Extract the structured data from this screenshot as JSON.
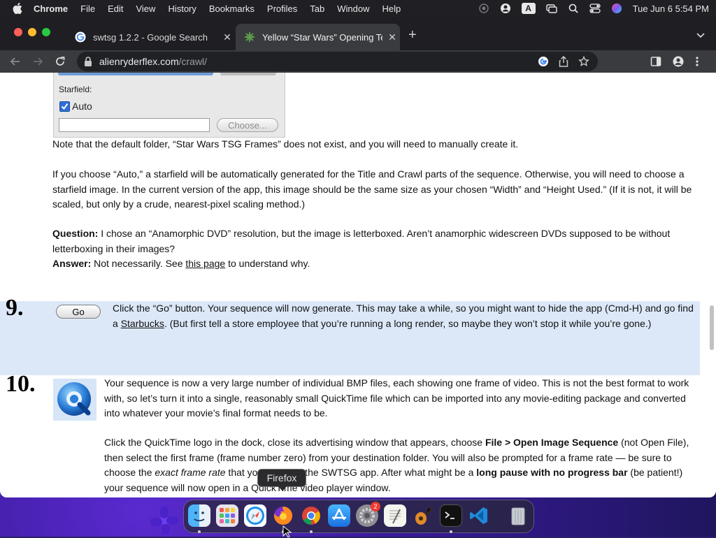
{
  "menubar": {
    "app_name": "Chrome",
    "items": [
      "File",
      "Edit",
      "View",
      "History",
      "Bookmarks",
      "Profiles",
      "Tab",
      "Window",
      "Help"
    ],
    "input_source": "A",
    "clock": "Tue Jun 6  5:54 PM"
  },
  "browser": {
    "tabs": [
      {
        "title": "swtsg 1.2.2 - Google Search",
        "icon": "google-favicon"
      },
      {
        "title": "Yellow “Star Wars” Opening Te",
        "icon": "site-favicon"
      }
    ],
    "url_domain": "alienryderflex.com",
    "url_path": "/crawl/"
  },
  "page": {
    "starfield_label": "Starfield:",
    "auto_label": "Auto",
    "choose_label": "Choose...",
    "note": "Note that the default folder, “Star Wars TSG Frames” does not exist, and you will need to manually create it.",
    "auto_para": "If you choose “Auto,” a starfield will be automatically generated for the Title and Crawl parts of the sequence. Otherwise, you will need to choose a starfield image. In the current version of the app, this image should be the same size as your chosen “Width” and “Height Used.” (If it is not, it will be scaled, but only by a crude, nearest-pixel scaling method.)",
    "question_label": "Question:",
    "question_text": " I chose an “Anamorphic DVD” resolution, but the image is letterboxed. Aren’t anamorphic widescreen DVDs supposed to be without letterboxing in their images?",
    "answer_label": "Answer:",
    "answer_text_1": " Not necessarily. See ",
    "answer_link": "this page",
    "answer_text_2": " to understand why.",
    "step9_num": "9.",
    "go_label": "Go",
    "step9_text_1": "Click the “Go” button. Your sequence will now generate. This may take a while, so you might want to hide the app (Cmd-H) and go find a ",
    "step9_link": "Starbucks",
    "step9_text_2": ". (But first tell a store employee that you’re running a long render, so maybe they won’t stop it while you’re gone.)",
    "step10_num": "10.",
    "step10_para1": "Your sequence is now a very large number of individual BMP files, each showing one frame of video. This is not the best format to work with, so let’s turn it into a single, reasonably small QuickTime file which can be imported into any movie-editing package and converted into whatever your movie’s final format needs to be.",
    "step10_p2_a": "Click the QuickTime logo in the dock, close its advertising window that appears, choose ",
    "step10_p2_bold1": "File > Open Image Sequence",
    "step10_p2_b": " (not Open File), then select the first frame (frame number zero) from your destination folder. You will also be prompted for a frame rate — be sure to choose the ",
    "step10_p2_italic": "exact frame rate",
    "step10_p2_c": " that you chose in the SWTSG app. After what might be a ",
    "step10_p2_bold2": "long pause with no progress bar",
    "step10_p2_d": " (be patient!) your sequence will now open in a QuickTime video player window."
  },
  "dock": {
    "tooltip": "Firefox",
    "apps": [
      "finder-icon",
      "launchpad-icon",
      "safari-icon",
      "firefox-icon",
      "chrome-icon",
      "app-store-icon",
      "system-settings-icon",
      "textedit-icon",
      "garageband-icon",
      "terminal-icon",
      "vscode-icon",
      "trash-icon"
    ],
    "settings_badge": "2"
  }
}
